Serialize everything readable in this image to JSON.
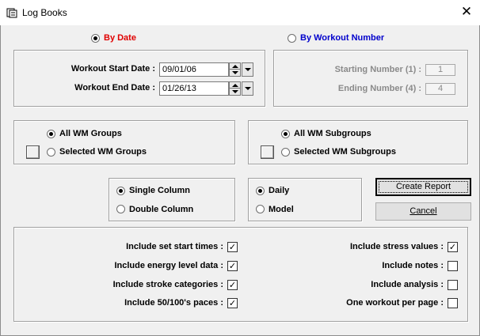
{
  "window": {
    "title": "Log Books",
    "close_glyph": "✕"
  },
  "mode": {
    "by_date_label": "By Date",
    "by_workout_number_label": "By Workout Number",
    "selected": "by_date",
    "accent_color": "#e00000",
    "link_color": "#0000cc"
  },
  "dates": {
    "start_label": "Workout Start Date :",
    "start_value": "09/01/06",
    "end_label": "Workout End Date :",
    "end_value": "01/26/13"
  },
  "numbers": {
    "starting_label": "Starting Number (1) :",
    "starting_value": "1",
    "ending_label": "Ending Number (4) :",
    "ending_value": "4"
  },
  "groups": {
    "all_label": "All WM Groups",
    "selected_label": "Selected WM Groups",
    "selected": "all"
  },
  "subgroups": {
    "all_label": "All WM Subgroups",
    "selected_label": "Selected WM Subgroups",
    "selected": "all"
  },
  "columns": {
    "single_label": "Single Column",
    "double_label": "Double Column",
    "selected": "single"
  },
  "period": {
    "daily_label": "Daily",
    "model_label": "Model",
    "selected": "daily"
  },
  "buttons": {
    "create_report": "Create Report",
    "cancel": "Cancel"
  },
  "options_left": [
    {
      "label": "Include set start times :",
      "checked": true
    },
    {
      "label": "Include energy level data :",
      "checked": true
    },
    {
      "label": "Include stroke categories :",
      "checked": true
    },
    {
      "label": "Include 50/100's paces :",
      "checked": true
    }
  ],
  "options_right": [
    {
      "label": "Include stress values :",
      "checked": true
    },
    {
      "label": "Include notes :",
      "checked": false
    },
    {
      "label": "Include analysis :",
      "checked": false
    },
    {
      "label": "One workout per page :",
      "checked": false
    }
  ]
}
